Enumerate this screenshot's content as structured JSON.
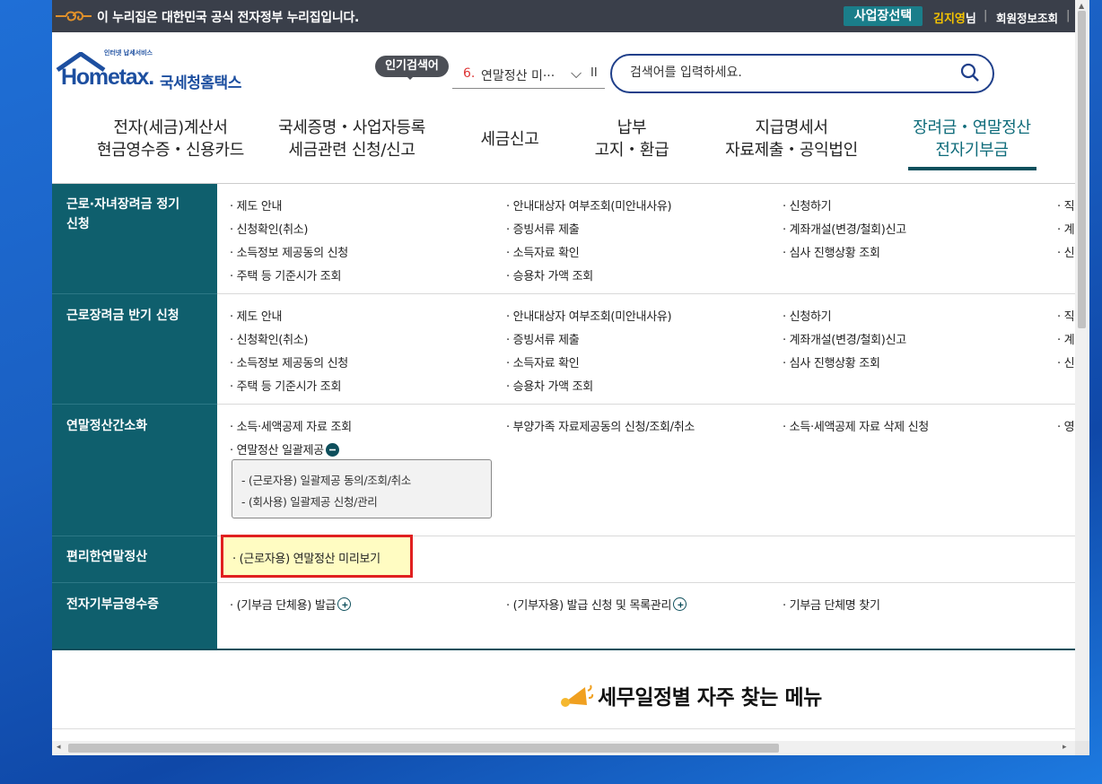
{
  "gov": {
    "text": "이 누리집은 대한민국 공식 전자정부 누리집입니다.",
    "biz_button": "사업장선택",
    "user_name": "김지영",
    "user_suffix": "님",
    "member_link": "회원정보조회"
  },
  "logo": {
    "small": "인터넷 납세서비스",
    "hometax": "Hometax.",
    "korean": "국세청홈택스"
  },
  "popular": {
    "tag": "인기검색어",
    "rank": "6.",
    "keyword": "연말정산 미···",
    "pause": "II"
  },
  "search": {
    "placeholder": "검색어를 입력하세요."
  },
  "nav": [
    {
      "line1": "전자(세금)계산서",
      "line2": "현금영수증・신용카드"
    },
    {
      "line1": "국세증명・사업자등록",
      "line2": "세금관련 신청/신고"
    },
    {
      "line1": "세금신고",
      "line2": ""
    },
    {
      "line1": "납부",
      "line2": "고지・환급"
    },
    {
      "line1": "지급명세서",
      "line2": "자료제출・공익법인"
    },
    {
      "line1": "장려금・연말정산",
      "line2": "전자기부금"
    }
  ],
  "menu": {
    "rows": [
      {
        "title_l1": "근로·자녀장려금 정기",
        "title_l2": "신청"
      },
      {
        "title_l1": "근로장려금 반기 신청",
        "title_l2": ""
      },
      {
        "title_l1": "연말정산간소화",
        "title_l2": ""
      },
      {
        "title_l1": "편리한연말정산",
        "title_l2": ""
      },
      {
        "title_l1": "전자기부금영수증",
        "title_l2": ""
      }
    ],
    "r1": {
      "c1": [
        "· 제도 안내",
        "· 신청확인(취소)",
        "· 소득정보 제공동의 신청",
        "· 주택 등 기준시가 조회"
      ],
      "c2": [
        "· 안내대상자 여부조회(미안내사유)",
        "· 증빙서류 제출",
        "· 소득자료 확인",
        "· 승용차 가액 조회"
      ],
      "c3": [
        "· 신청하기",
        "· 계좌개설(변경/철회)신고",
        "· 심사 진행상황 조회"
      ],
      "c4": [
        "· 직",
        "· 계",
        "· 신"
      ]
    },
    "r2": {
      "c1": [
        "· 제도 안내",
        "· 신청확인(취소)",
        "· 소득정보 제공동의 신청",
        "· 주택 등 기준시가 조회"
      ],
      "c2": [
        "· 안내대상자 여부조회(미안내사유)",
        "· 증빙서류 제출",
        "· 소득자료 확인",
        "· 승용차 가액 조회"
      ],
      "c3": [
        "· 신청하기",
        "· 계좌개설(변경/철회)신고",
        "· 심사 진행상황 조회"
      ],
      "c4": [
        "· 직",
        "· 계",
        "· 신"
      ]
    },
    "r3": {
      "c1": [
        "· 소득·세액공제 자료 조회",
        "· 연말정산 일괄제공"
      ],
      "sub": [
        "- (근로자용) 일괄제공 동의/조회/취소",
        "- (회사용) 일괄제공 신청/관리"
      ],
      "c2": [
        "· 부양가족 자료제공동의 신청/조회/취소"
      ],
      "c3": [
        "· 소득·세액공제 자료 삭제 신청"
      ],
      "c4": [
        "· 영"
      ]
    },
    "r4": {
      "c1": [
        "· (근로자용) 연말정산 미리보기"
      ]
    },
    "r5": {
      "c1": [
        "· (기부금 단체용) 발급"
      ],
      "c2": [
        "· (기부자용) 발급 신청 및 목록관리"
      ],
      "c3": [
        "· 기부금 단체명 찾기"
      ]
    }
  },
  "schedule": {
    "title": "세무일정별 자주 찾는 메뉴"
  },
  "colors": {
    "teal": "#0f5f6d",
    "navy": "#1f3f8a",
    "highlight_border": "#e02020",
    "highlight_bg": "#fffcc2"
  }
}
